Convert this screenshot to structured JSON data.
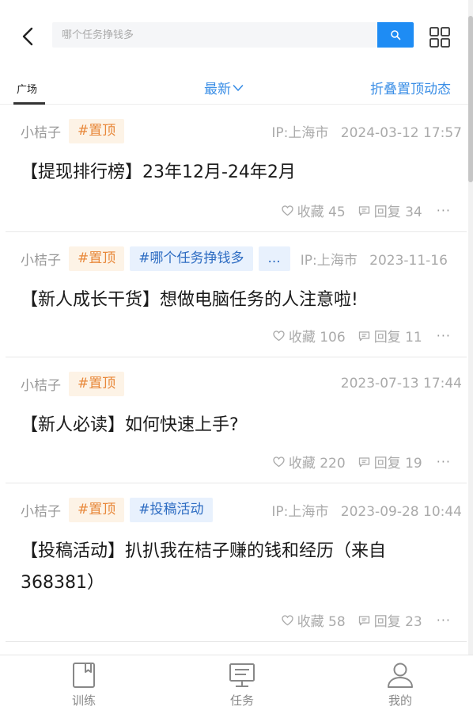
{
  "header": {
    "search_placeholder": "哪个任务挣钱多"
  },
  "tabs": {
    "square": "广场",
    "sort": "最新",
    "fold": "折叠置顶动态"
  },
  "posts": [
    {
      "author": "小桔子",
      "tags": [
        "#置顶"
      ],
      "ip": "IP:上海市",
      "time": "2024-03-12 17:57",
      "title": "【提现排行榜】23年12月-24年2月",
      "favorites": "收藏 45",
      "replies": "回复 34"
    },
    {
      "author": "小桔子",
      "tags": [
        "#置顶",
        "#哪个任务挣钱多",
        "..."
      ],
      "ip": "IP:上海市",
      "time": "2023-11-16",
      "title": "【新人成长干货】想做电脑任务的人注意啦!",
      "favorites": "收藏 106",
      "replies": "回复 11"
    },
    {
      "author": "小桔子",
      "tags": [
        "#置顶"
      ],
      "ip": "",
      "time": "2023-07-13 17:44",
      "title": "【新人必读】如何快速上手?",
      "favorites": "收藏 220",
      "replies": "回复 19"
    },
    {
      "author": "小桔子",
      "tags": [
        "#置顶",
        "#投稿活动"
      ],
      "ip": "IP:上海市",
      "time": "2023-09-28 10:44",
      "title": "【投稿活动】扒扒我在桔子赚的钱和经历（来自368381）",
      "favorites": "收藏 58",
      "replies": "回复 23"
    }
  ],
  "bottom_nav": {
    "train": "训练",
    "task": "任务",
    "mine": "我的"
  },
  "colors": {
    "accent": "#1e8cf4",
    "link": "#3a8ee6",
    "pin_tag_bg": "#fdf3e6",
    "pin_tag_text": "#e8883a",
    "topic_tag_bg": "#e8f1fd",
    "topic_tag_text": "#2d6cc2"
  }
}
